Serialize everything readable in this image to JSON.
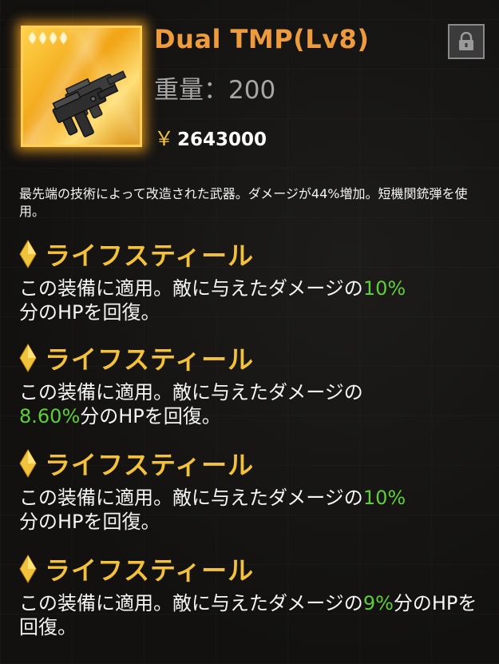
{
  "item": {
    "name": "Dual TMP(Lv8)",
    "weight": "重量：200",
    "price_symbol": "￥",
    "price": "2643000",
    "rarity_count": 4,
    "description": "最先端の技術によって改造された武器。ダメージが44%増加。短機関銃弾を使用。",
    "icons": {
      "lock": "lock-icon",
      "weapon": "smg-icon",
      "rarity": "diamond-icon"
    }
  },
  "skills": [
    {
      "name": "ライフスティール",
      "text_before": "この装備に適用。敵に与えたダメージの",
      "value": "10%",
      "text_after": "分のHPを回復。"
    },
    {
      "name": "ライフスティール",
      "text_before": "この装備に適用。敵に与えたダメージの",
      "value": "8.60%",
      "text_after": "分のHPを回復。"
    },
    {
      "name": "ライフスティール",
      "text_before": "この装備に適用。敵に与えたダメージの",
      "value": "10%",
      "text_after": "分のHPを回復。"
    },
    {
      "name": "ライフスティール",
      "text_before": "この装備に適用。敵に与えたダメージの",
      "value": "9%",
      "text_after": "分のHPを回復。"
    }
  ],
  "colors": {
    "title": "#ee9b3e",
    "skill_name": "#f4c23a",
    "highlight": "#5fcf37",
    "frame_glow": "#ffaa1e"
  }
}
